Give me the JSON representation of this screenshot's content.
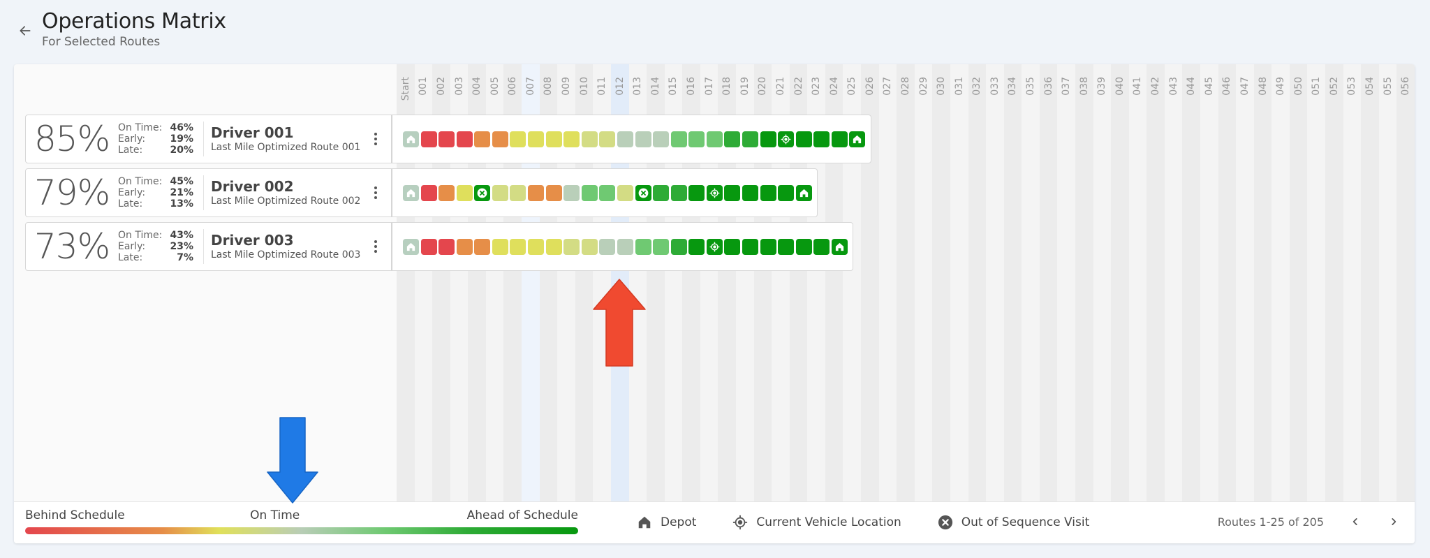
{
  "header": {
    "title": "Operations Matrix",
    "subtitle": "For Selected Routes"
  },
  "columns": [
    "Start",
    "001",
    "002",
    "003",
    "004",
    "005",
    "006",
    "007",
    "008",
    "009",
    "010",
    "011",
    "012",
    "013",
    "014",
    "015",
    "016",
    "017",
    "018",
    "019",
    "020",
    "021",
    "022",
    "023",
    "024",
    "025",
    "026",
    "027",
    "028",
    "029",
    "030",
    "031",
    "032",
    "033",
    "034",
    "035",
    "036",
    "037",
    "038",
    "039",
    "040",
    "041",
    "042",
    "043",
    "044",
    "045",
    "046",
    "047",
    "048",
    "049",
    "050",
    "051",
    "052",
    "053",
    "054",
    "055",
    "056"
  ],
  "highlighted_columns": {
    "light": "007",
    "strong": "012"
  },
  "status_colors": {
    "depot_start": "#b7cfbf",
    "red": "#e4464d",
    "orange": "#e68e48",
    "yellow": "#dfdf5c",
    "yellowgreen": "#d3dc84",
    "gray": "#b9cfb9",
    "lightgreen": "#6fc972",
    "midgreen": "#2eab36",
    "darkgreen": "#07980f"
  },
  "routes": [
    {
      "score": "85%",
      "on_time_label": "On Time:",
      "on_time": "46%",
      "early_label": "Early:",
      "early": "19%",
      "late_label": "Late:",
      "late": "20%",
      "driver": "Driver 001",
      "route": "Last Mile Optimized Route 001",
      "stops": [
        {
          "c": "depot_start",
          "icon": "depot"
        },
        {
          "c": "red"
        },
        {
          "c": "red"
        },
        {
          "c": "red"
        },
        {
          "c": "orange"
        },
        {
          "c": "orange"
        },
        {
          "c": "yellow"
        },
        {
          "c": "yellow"
        },
        {
          "c": "yellow"
        },
        {
          "c": "yellow"
        },
        {
          "c": "yellowgreen"
        },
        {
          "c": "yellowgreen"
        },
        {
          "c": "gray"
        },
        {
          "c": "gray"
        },
        {
          "c": "gray"
        },
        {
          "c": "lightgreen"
        },
        {
          "c": "lightgreen"
        },
        {
          "c": "lightgreen"
        },
        {
          "c": "midgreen"
        },
        {
          "c": "midgreen"
        },
        {
          "c": "darkgreen"
        },
        {
          "c": "darkgreen",
          "icon": "location"
        },
        {
          "c": "darkgreen"
        },
        {
          "c": "darkgreen"
        },
        {
          "c": "darkgreen"
        },
        {
          "c": "darkgreen",
          "icon": "depot"
        }
      ]
    },
    {
      "score": "79%",
      "on_time_label": "On Time:",
      "on_time": "45%",
      "early_label": "Early:",
      "early": "21%",
      "late_label": "Late:",
      "late": "13%",
      "driver": "Driver 002",
      "route": "Last Mile Optimized Route 002",
      "stops": [
        {
          "c": "depot_start",
          "icon": "depot"
        },
        {
          "c": "red"
        },
        {
          "c": "orange"
        },
        {
          "c": "yellow"
        },
        {
          "c": "darkgreen",
          "icon": "out-of-sequence"
        },
        {
          "c": "yellowgreen"
        },
        {
          "c": "yellowgreen"
        },
        {
          "c": "orange"
        },
        {
          "c": "orange"
        },
        {
          "c": "gray"
        },
        {
          "c": "lightgreen"
        },
        {
          "c": "lightgreen"
        },
        {
          "c": "yellowgreen"
        },
        {
          "c": "darkgreen",
          "icon": "out-of-sequence"
        },
        {
          "c": "midgreen"
        },
        {
          "c": "midgreen"
        },
        {
          "c": "darkgreen"
        },
        {
          "c": "darkgreen",
          "icon": "location"
        },
        {
          "c": "darkgreen"
        },
        {
          "c": "darkgreen"
        },
        {
          "c": "darkgreen"
        },
        {
          "c": "darkgreen"
        },
        {
          "c": "darkgreen",
          "icon": "depot"
        }
      ]
    },
    {
      "score": "73%",
      "on_time_label": "On Time:",
      "on_time": "43%",
      "early_label": "Early:",
      "early": "23%",
      "late_label": "Late:",
      "late": "7%",
      "driver": "Driver 003",
      "route": "Last Mile Optimized Route 003",
      "stops": [
        {
          "c": "depot_start",
          "icon": "depot"
        },
        {
          "c": "red"
        },
        {
          "c": "red"
        },
        {
          "c": "orange"
        },
        {
          "c": "orange"
        },
        {
          "c": "yellow"
        },
        {
          "c": "yellow"
        },
        {
          "c": "yellow"
        },
        {
          "c": "yellow"
        },
        {
          "c": "yellowgreen"
        },
        {
          "c": "yellowgreen"
        },
        {
          "c": "gray"
        },
        {
          "c": "gray"
        },
        {
          "c": "lightgreen"
        },
        {
          "c": "lightgreen"
        },
        {
          "c": "midgreen"
        },
        {
          "c": "darkgreen"
        },
        {
          "c": "darkgreen",
          "icon": "location"
        },
        {
          "c": "darkgreen"
        },
        {
          "c": "darkgreen"
        },
        {
          "c": "darkgreen"
        },
        {
          "c": "darkgreen"
        },
        {
          "c": "darkgreen"
        },
        {
          "c": "darkgreen"
        },
        {
          "c": "darkgreen",
          "icon": "depot"
        }
      ]
    }
  ],
  "footer": {
    "scale": {
      "behind": "Behind Schedule",
      "on_time": "On Time",
      "ahead": "Ahead of Schedule"
    },
    "legend": {
      "depot": "Depot",
      "location": "Current Vehicle Location",
      "out_of_sequence": "Out of Sequence Visit"
    },
    "pagination": "Routes 1-25 of 205"
  },
  "annotations": {
    "red_arrow_color": "#f04a30",
    "blue_arrow_color": "#1f7ae6"
  }
}
